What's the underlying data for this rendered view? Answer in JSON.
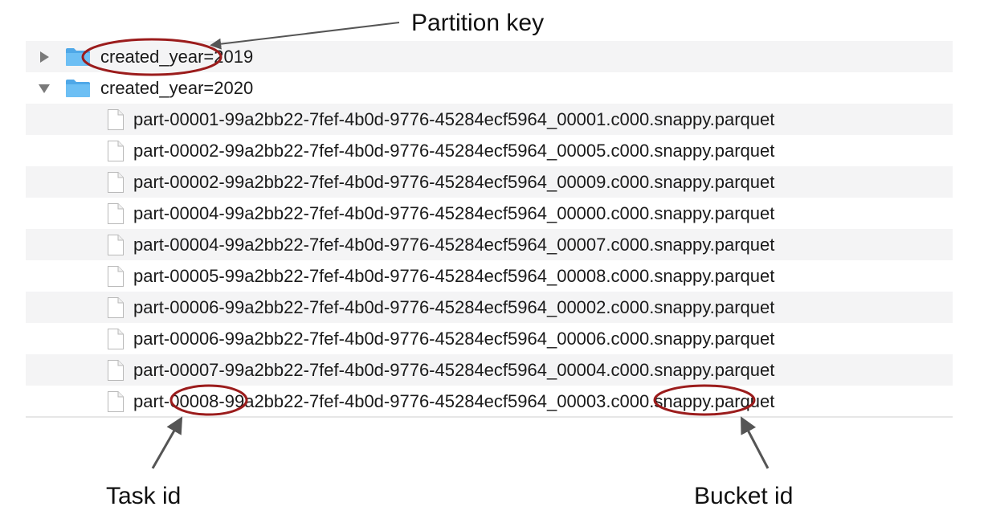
{
  "listing": {
    "folders": [
      {
        "name": "created_year=2019",
        "state": "collapsed",
        "disclosure_icon": "triangle-right"
      },
      {
        "name": "created_year=2020",
        "state": "expanded",
        "disclosure_icon": "triangle-down"
      }
    ],
    "files": [
      "part-00001-99a2bb22-7fef-4b0d-9776-45284ecf5964_00001.c000.snappy.parquet",
      "part-00002-99a2bb22-7fef-4b0d-9776-45284ecf5964_00005.c000.snappy.parquet",
      "part-00002-99a2bb22-7fef-4b0d-9776-45284ecf5964_00009.c000.snappy.parquet",
      "part-00004-99a2bb22-7fef-4b0d-9776-45284ecf5964_00000.c000.snappy.parquet",
      "part-00004-99a2bb22-7fef-4b0d-9776-45284ecf5964_00007.c000.snappy.parquet",
      "part-00005-99a2bb22-7fef-4b0d-9776-45284ecf5964_00008.c000.snappy.parquet",
      "part-00006-99a2bb22-7fef-4b0d-9776-45284ecf5964_00002.c000.snappy.parquet",
      "part-00006-99a2bb22-7fef-4b0d-9776-45284ecf5964_00006.c000.snappy.parquet",
      "part-00007-99a2bb22-7fef-4b0d-9776-45284ecf5964_00004.c000.snappy.parquet",
      "part-00008-99a2bb22-7fef-4b0d-9776-45284ecf5964_00003.c000.snappy.parquet"
    ],
    "folder_icon": "folder-icon",
    "file_icon": "document-icon"
  },
  "annotations": {
    "partition_key_label": "Partition key",
    "task_id_label": "Task id",
    "bucket_id_label": "Bucket id",
    "highlight_color": "#9b1c1c",
    "arrow_color": "#555555"
  },
  "colors": {
    "stripe": "#f4f4f5",
    "folder_blue": "#5bb4f0"
  }
}
